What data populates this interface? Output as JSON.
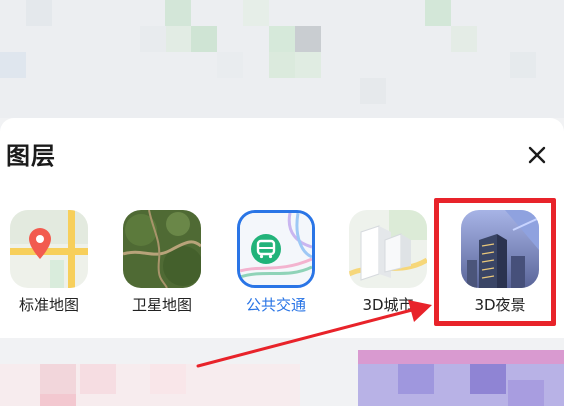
{
  "panel": {
    "title": "图层"
  },
  "layers": [
    {
      "label": "标准地图",
      "icon": "standard-map-icon",
      "active": false
    },
    {
      "label": "卫星地图",
      "icon": "satellite-map-icon",
      "active": false
    },
    {
      "label": "公共交通",
      "icon": "public-transit-icon",
      "active": true
    },
    {
      "label": "3D城市",
      "icon": "3d-city-icon",
      "active": false
    },
    {
      "label": "3D夜景",
      "icon": "3d-night-view-icon",
      "active": false
    }
  ],
  "colors": {
    "active_label": "#2a75e6",
    "highlight": "#e8232a",
    "panel_bg": "#ffffff",
    "sheet_bg": "#f1f2f4"
  }
}
